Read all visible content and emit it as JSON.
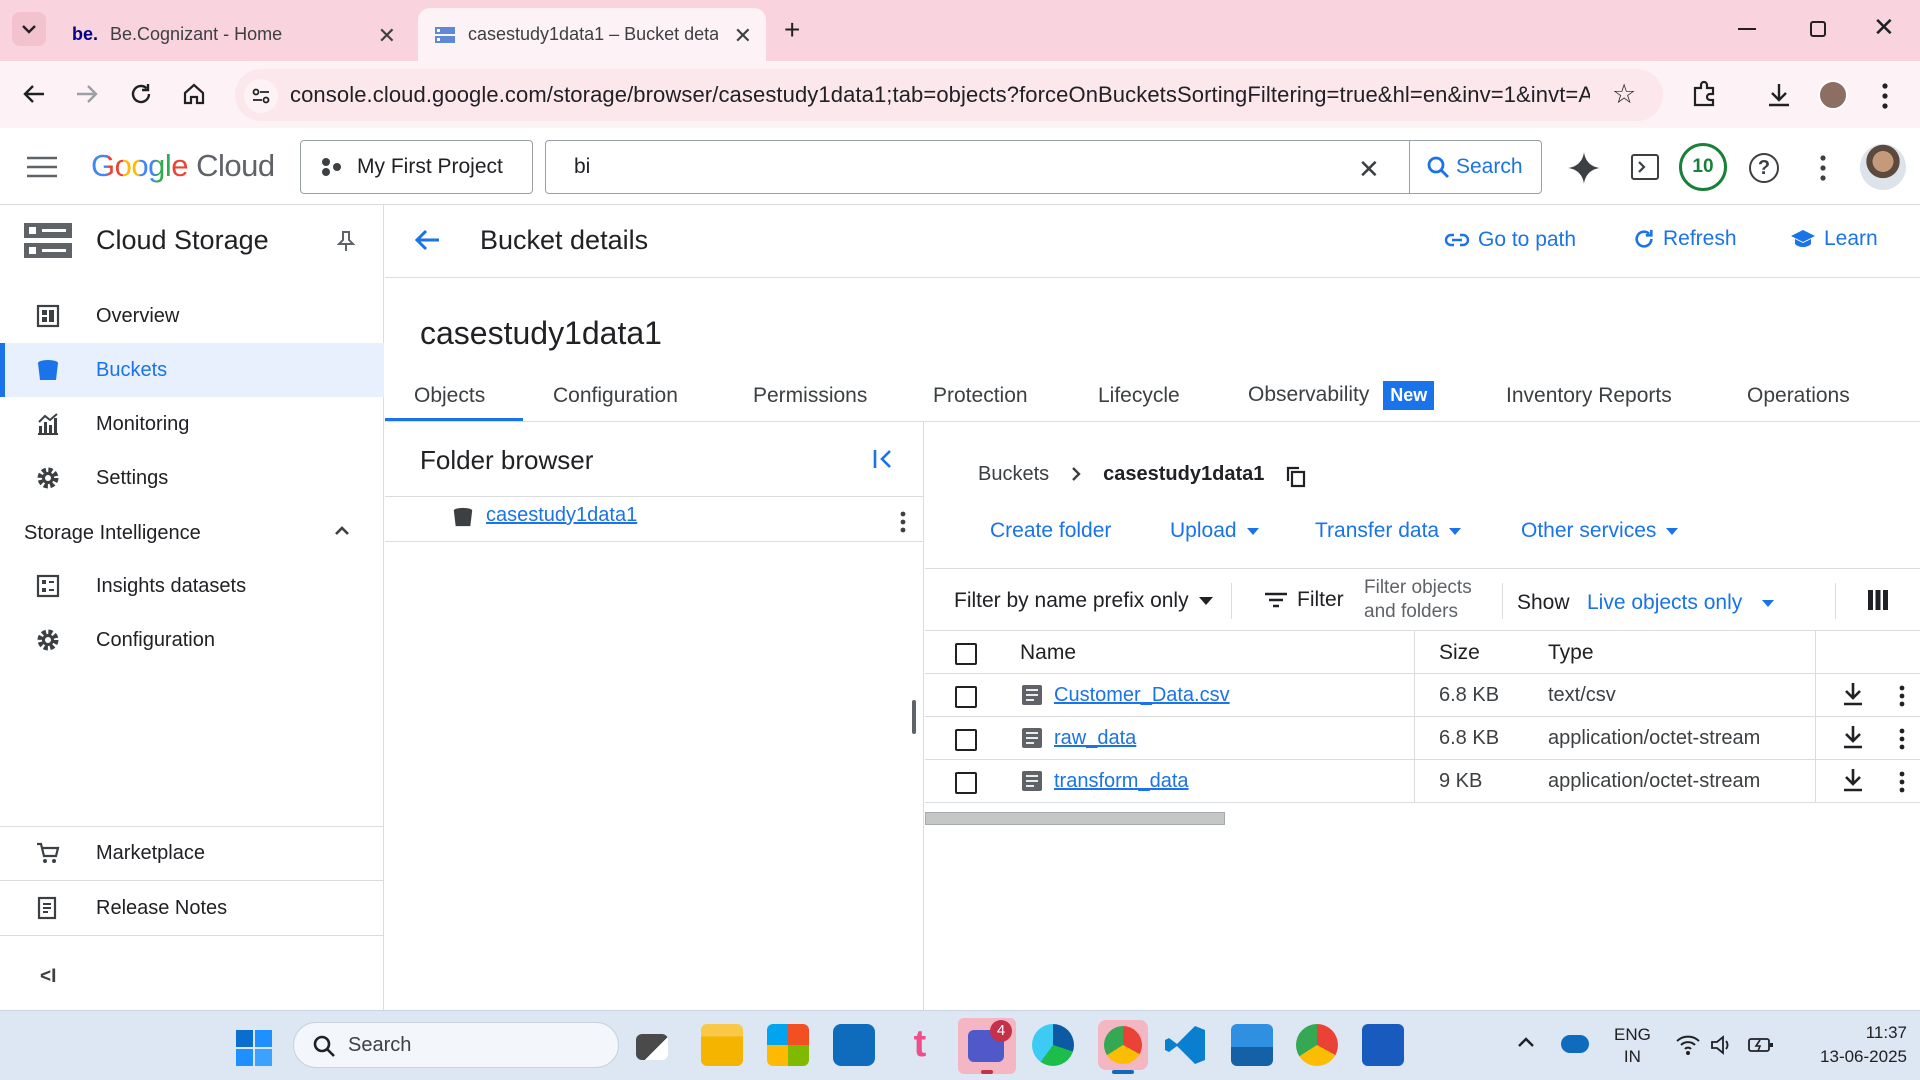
{
  "browser": {
    "tabs": [
      {
        "prefix": "be.",
        "title": "Be.Cognizant - Home"
      },
      {
        "title": "casestudy1data1 – Bucket detai"
      }
    ],
    "url": "console.cloud.google.com/storage/browser/casestudy1data1;tab=objects?forceOnBucketsSortingFiltering=true&hl=en&inv=1&invt=Abz-..."
  },
  "header": {
    "logo_google": "Google",
    "logo_cloud": "Cloud",
    "project": "My First Project",
    "search_value": "bi",
    "search_button": "Search",
    "notif_count": "10"
  },
  "sidebar": {
    "product": "Cloud Storage",
    "items": [
      {
        "label": "Overview",
        "icon": "dashboard-icon"
      },
      {
        "label": "Buckets",
        "icon": "bucket-icon"
      },
      {
        "label": "Monitoring",
        "icon": "monitoring-icon"
      },
      {
        "label": "Settings",
        "icon": "gear-icon"
      }
    ],
    "section": "Storage Intelligence",
    "section_items": [
      {
        "label": "Insights datasets",
        "icon": "dataset-icon"
      },
      {
        "label": "Configuration",
        "icon": "gear-icon"
      }
    ],
    "footer_items": [
      {
        "label": "Marketplace",
        "icon": "cart-icon"
      },
      {
        "label": "Release Notes",
        "icon": "notes-icon"
      }
    ]
  },
  "page": {
    "title": "Bucket details",
    "actions": {
      "go_to_path": "Go to path",
      "refresh": "Refresh",
      "learn": "Learn"
    },
    "bucket_name": "casestudy1data1",
    "tabs": [
      "Objects",
      "Configuration",
      "Permissions",
      "Protection",
      "Lifecycle",
      "Observability",
      "Inventory Reports",
      "Operations"
    ],
    "new_badge": "New",
    "active_tab": "Objects"
  },
  "folder_browser": {
    "title": "Folder browser",
    "root": "casestudy1data1"
  },
  "objects": {
    "breadcrumb_root": "Buckets",
    "breadcrumb_current": "casestudy1data1",
    "actions": {
      "create_folder": "Create folder",
      "upload": "Upload",
      "transfer_data": "Transfer data",
      "other_services": "Other services"
    },
    "filter_mode": "Filter by name prefix only",
    "filter_label": "Filter",
    "filter_placeholder_1": "Filter objects",
    "filter_placeholder_2": "and folders",
    "show_label": "Show",
    "show_value": "Live objects only",
    "columns": {
      "name": "Name",
      "size": "Size",
      "type": "Type"
    },
    "rows": [
      {
        "name": "Customer_Data.csv",
        "size": "6.8 KB",
        "type": "text/csv"
      },
      {
        "name": "raw_data",
        "size": "6.8 KB",
        "type": "application/octet-stream"
      },
      {
        "name": "transform_data",
        "size": "9 KB",
        "type": "application/octet-stream"
      }
    ]
  },
  "taskbar": {
    "search_placeholder": "Search",
    "teams_badge": "4",
    "lang_line1": "ENG",
    "lang_line2": "IN",
    "time": "11:37",
    "date": "13-06-2025"
  },
  "colors": {
    "accent": "#1a73e8",
    "tabbar": "#f9d3dd",
    "active_nav_bg": "#e8f0fe",
    "notif_ring": "#188038"
  }
}
